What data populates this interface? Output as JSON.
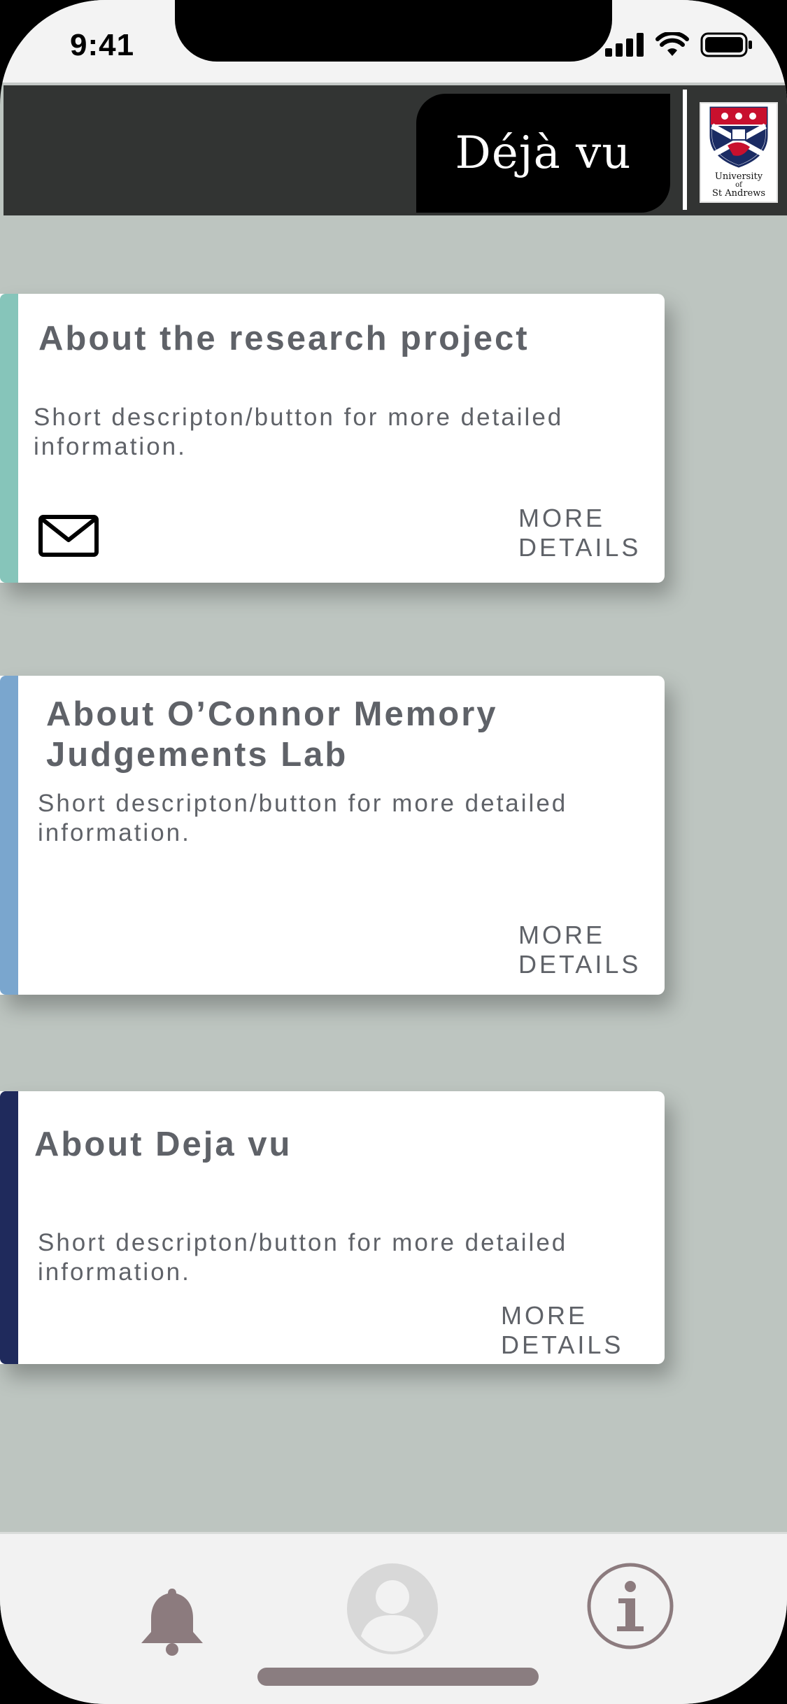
{
  "status_bar": {
    "time": "9:41"
  },
  "header": {
    "title": "Déjà vu",
    "logo_caption": [
      "University",
      "of",
      "St Andrews"
    ]
  },
  "cards": [
    {
      "title": "About the research project",
      "description": "Short descripton/button for more detailed information.",
      "link_line1": "MORE",
      "link_line2": "DETAILS",
      "accent_color": "#86c5ba",
      "icon": "mail-icon"
    },
    {
      "title_line1": "About O’Connor Memory",
      "title_line2": "Judgements Lab",
      "description": "Short descripton/button for more detailed information.",
      "link_line1": "MORE",
      "link_line2": "DETAILS",
      "accent_color": "#7aa6ce"
    },
    {
      "title": "About Deja vu",
      "description": "Short descripton/button for more detailed information.",
      "link_line1": "MORE",
      "link_line2": "DETAILS",
      "accent_color": "#1f2a5c"
    }
  ],
  "tab_bar": {
    "items": [
      {
        "icon": "bell-icon",
        "color": "#8c7b7e"
      },
      {
        "icon": "profile-icon",
        "color": "#d8d8d8"
      },
      {
        "icon": "info-icon",
        "color": "#8c7b7e"
      }
    ]
  }
}
